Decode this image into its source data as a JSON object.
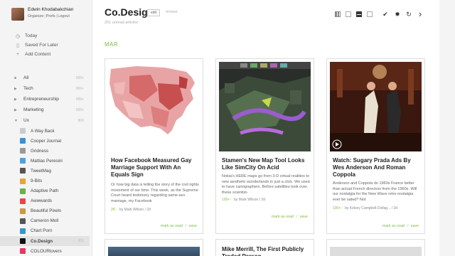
{
  "user": {
    "name": "Edwin Khodabakchian",
    "links": [
      "Organize",
      "Prefs",
      "Logout"
    ]
  },
  "nav": [
    {
      "label": "Today",
      "icon": "clock-icon"
    },
    {
      "label": "Saved For Later",
      "icon": "bookmark-icon"
    },
    {
      "label": "Add Content",
      "icon": "plus-icon"
    }
  ],
  "categories": [
    {
      "label": "All",
      "count": "999+"
    },
    {
      "label": "Tech",
      "count": "999+"
    },
    {
      "label": "Entrepreneurship",
      "count": "999+"
    },
    {
      "label": "Marketing",
      "count": "999+"
    },
    {
      "label": "Ux",
      "count": "800"
    }
  ],
  "feeds": [
    {
      "label": "A Way Back",
      "count": "",
      "color": "#ccc"
    },
    {
      "label": "Cooper Journal",
      "count": "",
      "color": "#3a8fd6"
    },
    {
      "label": "Gridness",
      "count": "",
      "color": "#999"
    },
    {
      "label": "Mattias Peresini",
      "count": "",
      "color": "#4aa3df"
    },
    {
      "label": "TweetMag",
      "count": "",
      "color": "#555"
    },
    {
      "label": "9-Bits",
      "count": "",
      "color": "#e9a33a"
    },
    {
      "label": "Adaptive Path",
      "count": "",
      "color": "#6bb04a"
    },
    {
      "label": "Awwwards",
      "count": "",
      "color": "#e44"
    },
    {
      "label": "Beautiful Pixels",
      "count": "",
      "color": "#c94"
    },
    {
      "label": "Cameron Moll",
      "count": "",
      "color": "#555"
    },
    {
      "label": "Chart Porn",
      "count": "",
      "color": "#39c"
    },
    {
      "label": "Co.Design",
      "count": "201",
      "color": "#111",
      "active": true
    },
    {
      "label": "COLOURlovers",
      "count": "",
      "color": "#e36"
    }
  ],
  "main": {
    "title": "Co.Design",
    "edit": "edit",
    "remove": "remove",
    "unread": "201 unread articles",
    "section": "MAR"
  },
  "toolbar": {
    "check": "✔",
    "settings": "✹",
    "refresh": "↻",
    "next": "›"
  },
  "cards": [
    {
      "title": "How Facebook Measured Gay Marriage Support With An Equals Sign",
      "summary": "Or how big data is telling the story of the civil rights movement of our time. This week, as the Supreme Court heard testimony regarding same-sex marriage, my Facebook",
      "likes": "2K♡",
      "author": "by Mark Wilson / 2d"
    },
    {
      "title": "Stamen's New Map Tool Looks Like SimCity On Acid",
      "summary": "Nokia's HERE maps go from 3-D virtual realities to new aesthetic wonderlands in just a click. We used to have cartographers. Before satellites took over, these scientist-",
      "likes": "100+♡",
      "author": "by Mark Wilson / 2d"
    },
    {
      "title": "Watch: Sugary Prada Ads By Wes Anderson And Roman Coppola",
      "summary": "Anderson and Coppola do 1960s France better than actual French directors from the 1960s. Will our nostalgia for the New Wave retro-nostalgia ever be sated? Not",
      "likes": "100+♡",
      "author": "by Kelsey Campbell-Dollag... / 2d"
    }
  ],
  "card_actions": {
    "read": "mark as read",
    "save": "save"
  },
  "bottom_cards": [
    {
      "title": "",
      "kind": "image"
    },
    {
      "title": "Mike Merrill, The First Publicly Traded Person",
      "kind": "text"
    },
    {
      "title": "",
      "kind": "image"
    }
  ]
}
